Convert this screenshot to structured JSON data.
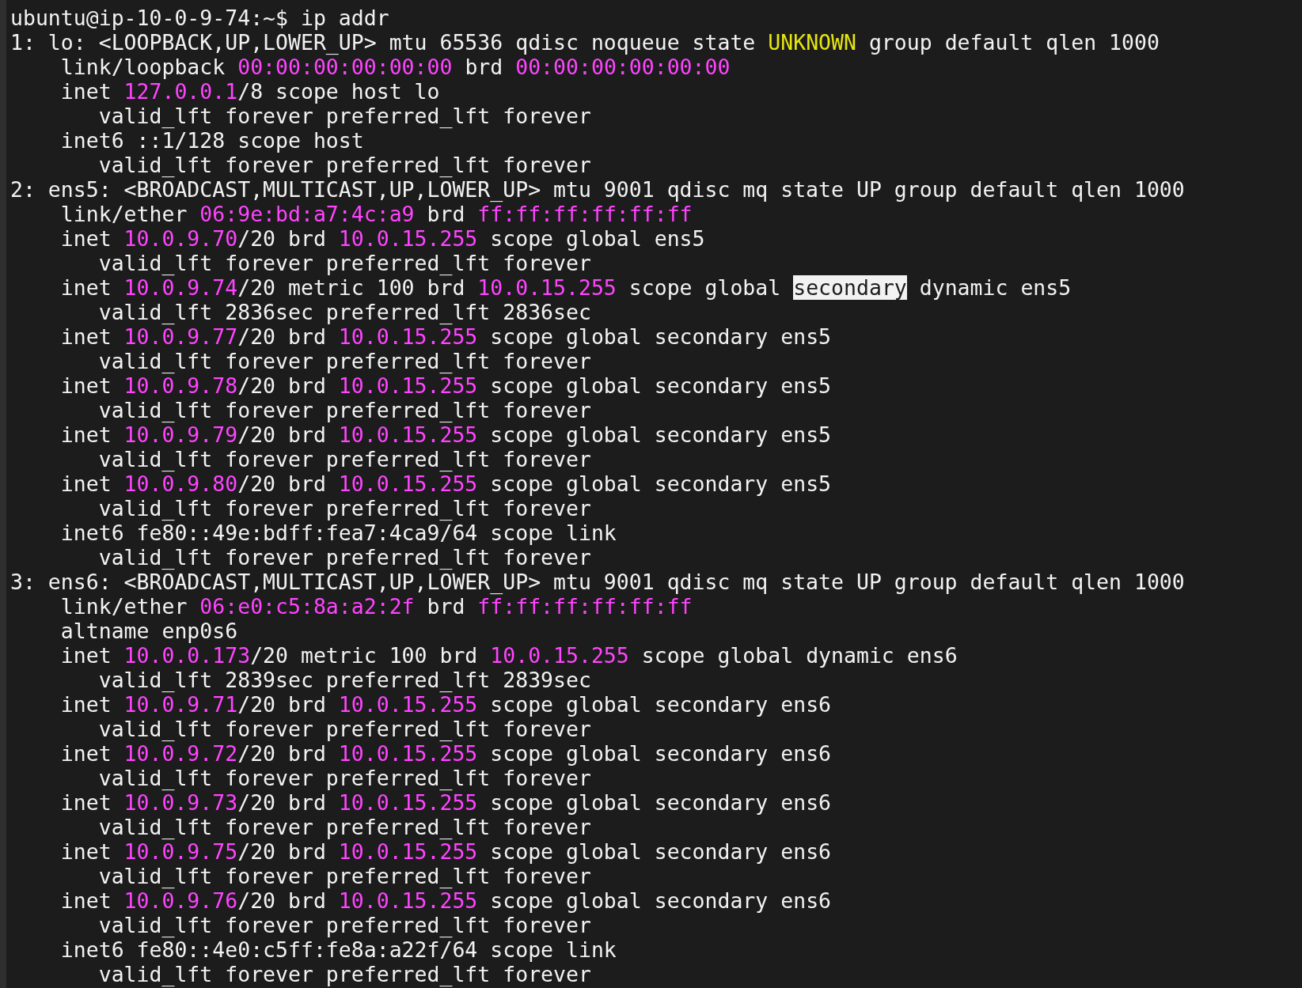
{
  "terminal": {
    "lines": [
      [
        {
          "kind": "plain",
          "text": "ubuntu@ip-10-0-9-74:~$ ip addr"
        }
      ],
      [
        {
          "kind": "plain",
          "text": "1: lo: <LOOPBACK,UP,LOWER_UP> mtu 65536 qdisc noqueue state "
        },
        {
          "kind": "state",
          "text": "UNKNOWN"
        },
        {
          "kind": "plain",
          "text": " group default qlen 1000"
        }
      ],
      [
        {
          "kind": "plain",
          "text": "    link/loopback "
        },
        {
          "kind": "address",
          "text": "00:00:00:00:00:00"
        },
        {
          "kind": "plain",
          "text": " brd "
        },
        {
          "kind": "address",
          "text": "00:00:00:00:00:00"
        }
      ],
      [
        {
          "kind": "plain",
          "text": "    inet "
        },
        {
          "kind": "address",
          "text": "127.0.0.1"
        },
        {
          "kind": "plain",
          "text": "/8 scope host lo"
        }
      ],
      [
        {
          "kind": "plain",
          "text": "       valid_lft forever preferred_lft forever"
        }
      ],
      [
        {
          "kind": "plain",
          "text": "    inet6 ::1/128 scope host"
        }
      ],
      [
        {
          "kind": "plain",
          "text": "       valid_lft forever preferred_lft forever"
        }
      ],
      [
        {
          "kind": "plain",
          "text": "2: ens5: <BROADCAST,MULTICAST,UP,LOWER_UP> mtu 9001 qdisc mq state UP group default qlen 1000"
        }
      ],
      [
        {
          "kind": "plain",
          "text": "    link/ether "
        },
        {
          "kind": "address",
          "text": "06:9e:bd:a7:4c:a9"
        },
        {
          "kind": "plain",
          "text": " brd "
        },
        {
          "kind": "address",
          "text": "ff:ff:ff:ff:ff:ff"
        }
      ],
      [
        {
          "kind": "plain",
          "text": "    inet "
        },
        {
          "kind": "address",
          "text": "10.0.9.70"
        },
        {
          "kind": "plain",
          "text": "/20 brd "
        },
        {
          "kind": "address",
          "text": "10.0.15.255"
        },
        {
          "kind": "plain",
          "text": " scope global ens5"
        }
      ],
      [
        {
          "kind": "plain",
          "text": "       valid_lft forever preferred_lft forever"
        }
      ],
      [
        {
          "kind": "plain",
          "text": "    inet "
        },
        {
          "kind": "address",
          "text": "10.0.9.74"
        },
        {
          "kind": "plain",
          "text": "/20 metric 100 brd "
        },
        {
          "kind": "address",
          "text": "10.0.15.255"
        },
        {
          "kind": "plain",
          "text": " scope global "
        },
        {
          "kind": "highlight",
          "text": "secondary"
        },
        {
          "kind": "plain",
          "text": " dynamic ens5"
        }
      ],
      [
        {
          "kind": "plain",
          "text": "       valid_lft 2836sec preferred_lft 2836sec"
        }
      ],
      [
        {
          "kind": "plain",
          "text": "    inet "
        },
        {
          "kind": "address",
          "text": "10.0.9.77"
        },
        {
          "kind": "plain",
          "text": "/20 brd "
        },
        {
          "kind": "address",
          "text": "10.0.15.255"
        },
        {
          "kind": "plain",
          "text": " scope global secondary ens5"
        }
      ],
      [
        {
          "kind": "plain",
          "text": "       valid_lft forever preferred_lft forever"
        }
      ],
      [
        {
          "kind": "plain",
          "text": "    inet "
        },
        {
          "kind": "address",
          "text": "10.0.9.78"
        },
        {
          "kind": "plain",
          "text": "/20 brd "
        },
        {
          "kind": "address",
          "text": "10.0.15.255"
        },
        {
          "kind": "plain",
          "text": " scope global secondary ens5"
        }
      ],
      [
        {
          "kind": "plain",
          "text": "       valid_lft forever preferred_lft forever"
        }
      ],
      [
        {
          "kind": "plain",
          "text": "    inet "
        },
        {
          "kind": "address",
          "text": "10.0.9.79"
        },
        {
          "kind": "plain",
          "text": "/20 brd "
        },
        {
          "kind": "address",
          "text": "10.0.15.255"
        },
        {
          "kind": "plain",
          "text": " scope global secondary ens5"
        }
      ],
      [
        {
          "kind": "plain",
          "text": "       valid_lft forever preferred_lft forever"
        }
      ],
      [
        {
          "kind": "plain",
          "text": "    inet "
        },
        {
          "kind": "address",
          "text": "10.0.9.80"
        },
        {
          "kind": "plain",
          "text": "/20 brd "
        },
        {
          "kind": "address",
          "text": "10.0.15.255"
        },
        {
          "kind": "plain",
          "text": " scope global secondary ens5"
        }
      ],
      [
        {
          "kind": "plain",
          "text": "       valid_lft forever preferred_lft forever"
        }
      ],
      [
        {
          "kind": "plain",
          "text": "    inet6 fe80::49e:bdff:fea7:4ca9/64 scope link"
        }
      ],
      [
        {
          "kind": "plain",
          "text": "       valid_lft forever preferred_lft forever"
        }
      ],
      [
        {
          "kind": "plain",
          "text": "3: ens6: <BROADCAST,MULTICAST,UP,LOWER_UP> mtu 9001 qdisc mq state UP group default qlen 1000"
        }
      ],
      [
        {
          "kind": "plain",
          "text": "    link/ether "
        },
        {
          "kind": "address",
          "text": "06:e0:c5:8a:a2:2f"
        },
        {
          "kind": "plain",
          "text": " brd "
        },
        {
          "kind": "address",
          "text": "ff:ff:ff:ff:ff:ff"
        }
      ],
      [
        {
          "kind": "plain",
          "text": "    altname enp0s6"
        }
      ],
      [
        {
          "kind": "plain",
          "text": "    inet "
        },
        {
          "kind": "address",
          "text": "10.0.0.173"
        },
        {
          "kind": "plain",
          "text": "/20 metric 100 brd "
        },
        {
          "kind": "address",
          "text": "10.0.15.255"
        },
        {
          "kind": "plain",
          "text": " scope global dynamic ens6"
        }
      ],
      [
        {
          "kind": "plain",
          "text": "       valid_lft 2839sec preferred_lft 2839sec"
        }
      ],
      [
        {
          "kind": "plain",
          "text": "    inet "
        },
        {
          "kind": "address",
          "text": "10.0.9.71"
        },
        {
          "kind": "plain",
          "text": "/20 brd "
        },
        {
          "kind": "address",
          "text": "10.0.15.255"
        },
        {
          "kind": "plain",
          "text": " scope global secondary ens6"
        }
      ],
      [
        {
          "kind": "plain",
          "text": "       valid_lft forever preferred_lft forever"
        }
      ],
      [
        {
          "kind": "plain",
          "text": "    inet "
        },
        {
          "kind": "address",
          "text": "10.0.9.72"
        },
        {
          "kind": "plain",
          "text": "/20 brd "
        },
        {
          "kind": "address",
          "text": "10.0.15.255"
        },
        {
          "kind": "plain",
          "text": " scope global secondary ens6"
        }
      ],
      [
        {
          "kind": "plain",
          "text": "       valid_lft forever preferred_lft forever"
        }
      ],
      [
        {
          "kind": "plain",
          "text": "    inet "
        },
        {
          "kind": "address",
          "text": "10.0.9.73"
        },
        {
          "kind": "plain",
          "text": "/20 brd "
        },
        {
          "kind": "address",
          "text": "10.0.15.255"
        },
        {
          "kind": "plain",
          "text": " scope global secondary ens6"
        }
      ],
      [
        {
          "kind": "plain",
          "text": "       valid_lft forever preferred_lft forever"
        }
      ],
      [
        {
          "kind": "plain",
          "text": "    inet "
        },
        {
          "kind": "address",
          "text": "10.0.9.75"
        },
        {
          "kind": "plain",
          "text": "/20 brd "
        },
        {
          "kind": "address",
          "text": "10.0.15.255"
        },
        {
          "kind": "plain",
          "text": " scope global secondary ens6"
        }
      ],
      [
        {
          "kind": "plain",
          "text": "       valid_lft forever preferred_lft forever"
        }
      ],
      [
        {
          "kind": "plain",
          "text": "    inet "
        },
        {
          "kind": "address",
          "text": "10.0.9.76"
        },
        {
          "kind": "plain",
          "text": "/20 brd "
        },
        {
          "kind": "address",
          "text": "10.0.15.255"
        },
        {
          "kind": "plain",
          "text": " scope global secondary ens6"
        }
      ],
      [
        {
          "kind": "plain",
          "text": "       valid_lft forever preferred_lft forever"
        }
      ],
      [
        {
          "kind": "plain",
          "text": "    inet6 fe80::4e0:c5ff:fe8a:a22f/64 scope link"
        }
      ],
      [
        {
          "kind": "plain",
          "text": "       valid_lft forever preferred_lft forever"
        }
      ]
    ]
  }
}
